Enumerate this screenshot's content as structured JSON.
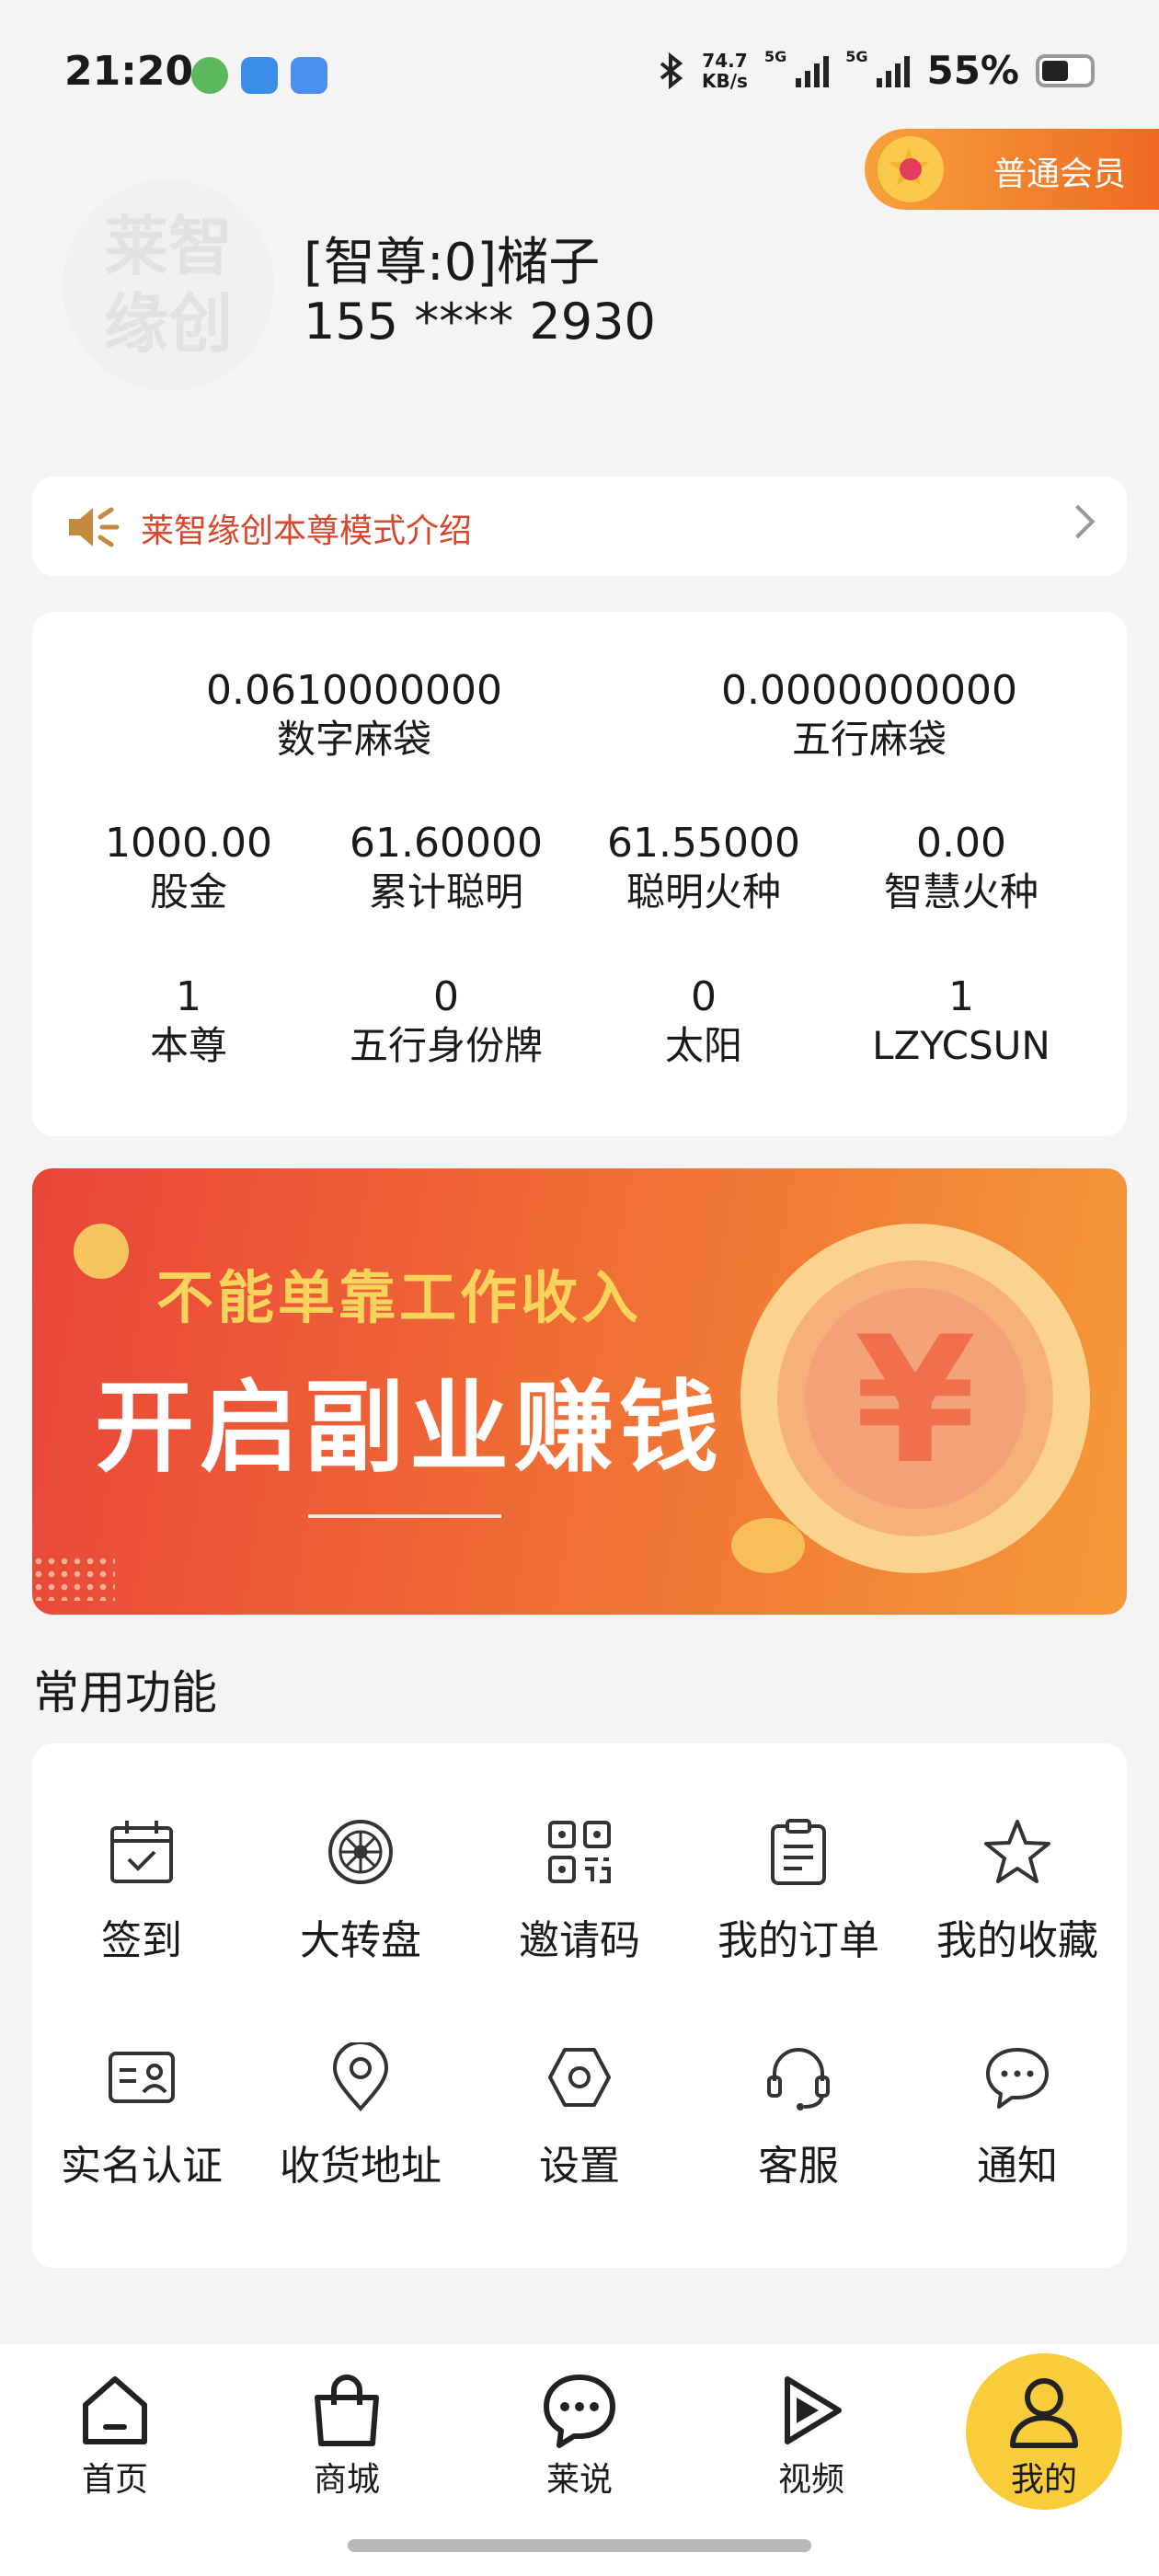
{
  "status_bar": {
    "time": "21:20",
    "net_speed_value": "74.7",
    "net_speed_unit": "KB/s",
    "sim1": "5G",
    "sim2": "5G",
    "battery": "55%",
    "battery_level": 0.55
  },
  "member": {
    "label": "普通会员"
  },
  "profile": {
    "avatar_text": "莱智缘创",
    "name": "[智尊:0]槠子",
    "phone": "155 **** 2930"
  },
  "intro": {
    "label": "莱智缘创本尊模式介绍"
  },
  "stats": {
    "row1": [
      {
        "value": "0.0610000000",
        "label": "数字麻袋"
      },
      {
        "value": "0.0000000000",
        "label": "五行麻袋"
      }
    ],
    "row2": [
      {
        "value": "1000.00",
        "label": "股金"
      },
      {
        "value": "61.60000",
        "label": "累计聪明"
      },
      {
        "value": "61.55000",
        "label": "聪明火种"
      },
      {
        "value": "0.00",
        "label": "智慧火种"
      }
    ],
    "row3": [
      {
        "value": "1",
        "label": "本尊"
      },
      {
        "value": "0",
        "label": "五行身份牌"
      },
      {
        "value": "0",
        "label": "太阳"
      },
      {
        "value": "1",
        "label": "LZYCSUN"
      }
    ]
  },
  "banner": {
    "line1": "不能单靠工作收入",
    "line2": "开启副业赚钱",
    "coin_symbol": "¥"
  },
  "functions": {
    "title": "常用功能",
    "items": [
      {
        "label": "签到",
        "icon": "calendar-check-icon"
      },
      {
        "label": "大转盘",
        "icon": "wheel-icon"
      },
      {
        "label": "邀请码",
        "icon": "qr-code-icon"
      },
      {
        "label": "我的订单",
        "icon": "clipboard-icon"
      },
      {
        "label": "我的收藏",
        "icon": "star-icon"
      },
      {
        "label": "实名认证",
        "icon": "id-card-icon"
      },
      {
        "label": "收货地址",
        "icon": "location-pin-icon"
      },
      {
        "label": "设置",
        "icon": "hexagon-settings-icon"
      },
      {
        "label": "客服",
        "icon": "headset-icon"
      },
      {
        "label": "通知",
        "icon": "chat-bubble-icon"
      }
    ]
  },
  "nav": {
    "items": [
      {
        "label": "首页",
        "icon": "home-icon"
      },
      {
        "label": "商城",
        "icon": "shopping-bag-icon"
      },
      {
        "label": "莱说",
        "icon": "chat-icon"
      },
      {
        "label": "视频",
        "icon": "play-icon"
      },
      {
        "label": "我的",
        "icon": "user-icon"
      }
    ],
    "active": "我的",
    "active_color": "#f8cc3a"
  },
  "colors": {
    "accent_orange": "#ee6a23",
    "intro_red": "#d8472b"
  }
}
